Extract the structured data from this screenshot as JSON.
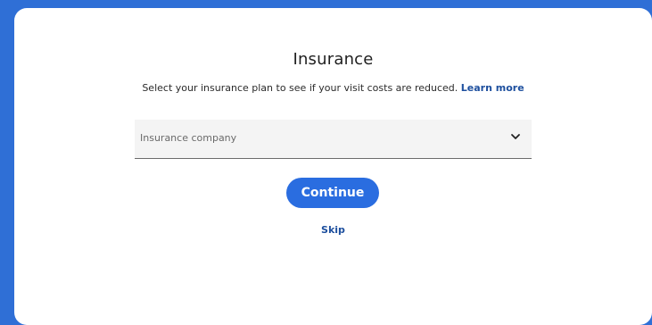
{
  "modal": {
    "title": "Insurance",
    "subtitle": "Select your insurance plan to see if your visit costs are reduced.",
    "learn_more_label": "Learn more",
    "select": {
      "placeholder": "Insurance company",
      "icon": "chevron-down-icon"
    },
    "continue_label": "Continue",
    "skip_label": "Skip"
  },
  "colors": {
    "background": "#2f6fd6",
    "card": "#ffffff",
    "primary": "#2a6de0",
    "link": "#1d4f9e",
    "select_bg": "#f4f4f4"
  }
}
